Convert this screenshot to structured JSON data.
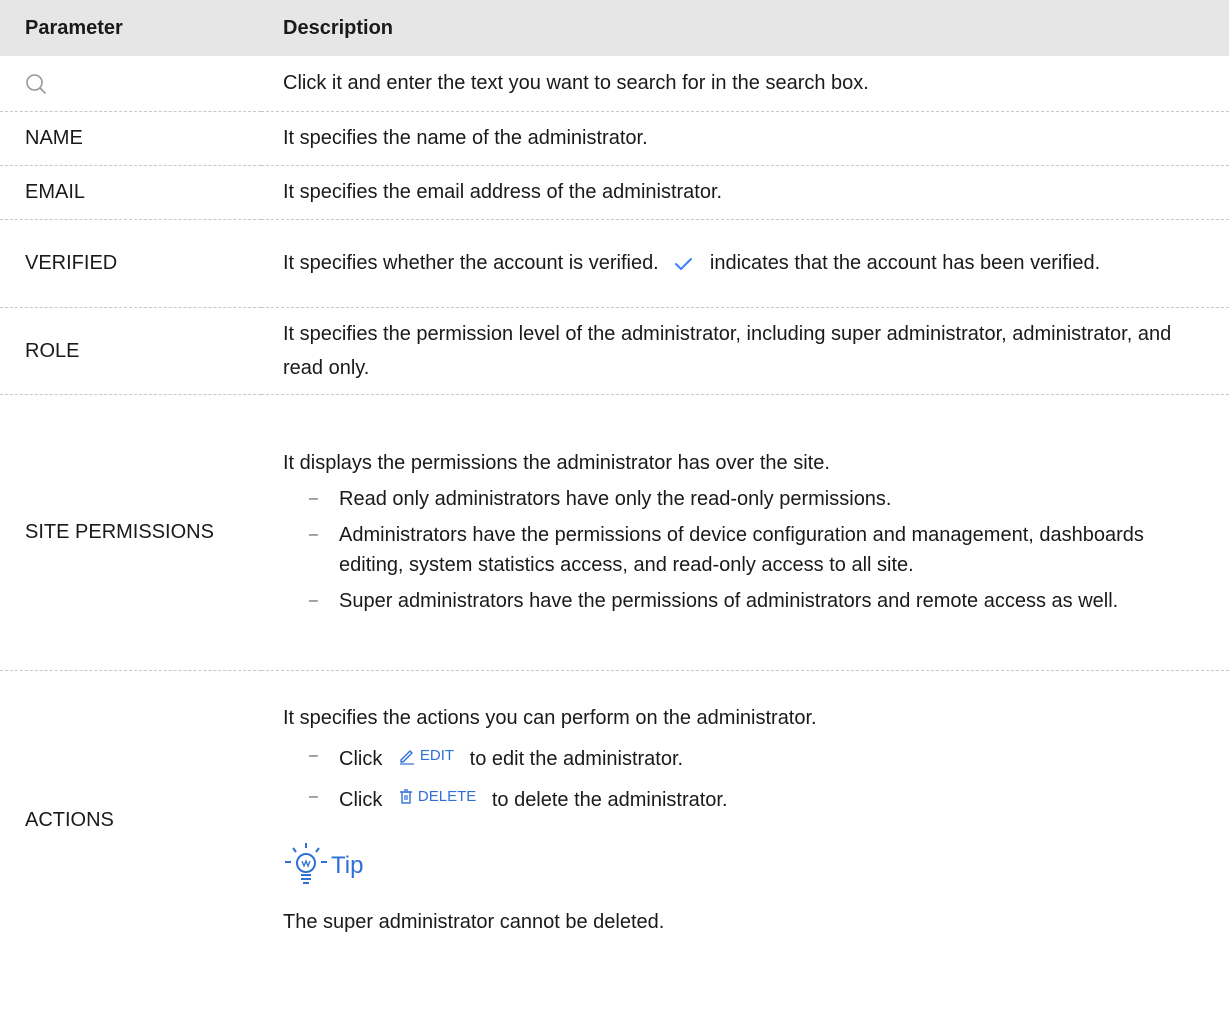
{
  "header": {
    "parameter": "Parameter",
    "description": "Description"
  },
  "rows": {
    "search": {
      "description": "Click it and enter the text you want to search for in the search box."
    },
    "name": {
      "param": "NAME",
      "description": "It specifies the name of the administrator."
    },
    "email": {
      "param": "EMAIL",
      "description": "It specifies the email address of the administrator."
    },
    "verified": {
      "param": "VERIFIED",
      "desc_before": "It specifies whether the account is verified.",
      "desc_after": "indicates that the account has been verified."
    },
    "role": {
      "param": "ROLE",
      "description": "It specifies the permission level of the administrator, including super administrator, administrator, and read only."
    },
    "site_permissions": {
      "param": "SITE PERMISSIONS",
      "intro": "It displays the permissions the administrator has over the site.",
      "bullets": [
        "Read only administrators have only the read-only permissions.",
        "Administrators have the permissions of device configuration and management, dashboards editing, system statistics access, and read-only access to all site.",
        "Super administrators have the permissions of administrators and remote access as well."
      ]
    },
    "actions": {
      "param": "ACTIONS",
      "intro": "It specifies the actions you can perform on the administrator.",
      "edit_click": "Click",
      "edit_label": "EDIT",
      "edit_suffix": "to edit the administrator.",
      "delete_click": "Click",
      "delete_label": "DELETE",
      "delete_suffix": "to delete the administrator.",
      "tip_label": "Tip",
      "tip_text": "The super administrator cannot be deleted."
    }
  },
  "colors": {
    "accent": "#2f6fd8",
    "check": "#3b82f6",
    "header_bg": "#e6e6e6"
  }
}
